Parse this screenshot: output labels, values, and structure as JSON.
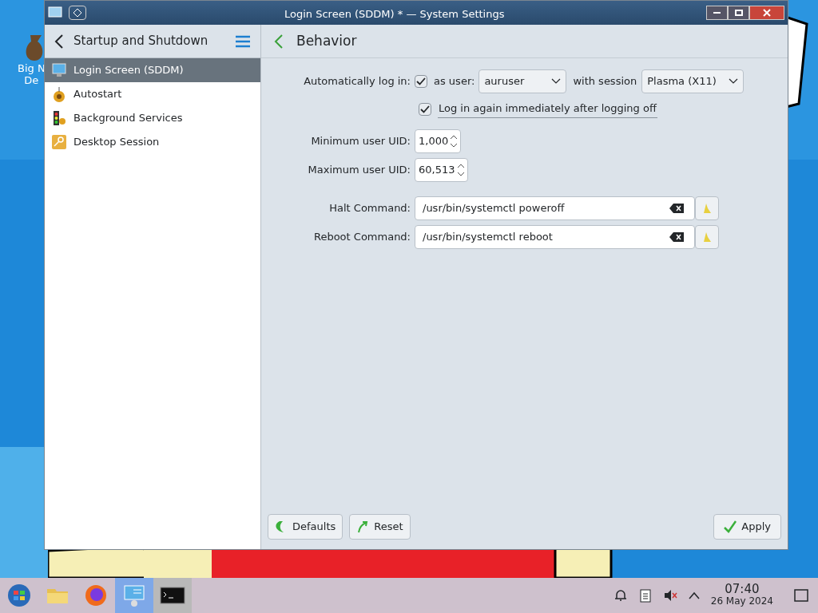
{
  "desktop": {
    "icon_label_lines": [
      "Big N",
      "De"
    ]
  },
  "window": {
    "title": "Login Screen (SDDM) * — System Settings"
  },
  "sidebar": {
    "title": "Startup and Shutdown",
    "items": [
      {
        "label": "Login Screen (SDDM)",
        "kind": "monitor",
        "selected": true
      },
      {
        "label": "Autostart",
        "kind": "gears",
        "selected": false
      },
      {
        "label": "Background Services",
        "kind": "traffic",
        "selected": false
      },
      {
        "label": "Desktop Session",
        "kind": "key",
        "selected": false
      }
    ]
  },
  "page": {
    "title": "Behavior",
    "autologin": {
      "label": "Automatically log in:",
      "checked": true,
      "user_label": "as user:",
      "user": "auruser",
      "session_label": "with session",
      "session": "Plasma (X11)"
    },
    "relogin": {
      "label": "Log in again immediately after logging off",
      "checked": true
    },
    "min_uid": {
      "label": "Minimum user UID:",
      "value": "1,000"
    },
    "max_uid": {
      "label": "Maximum user UID:",
      "value": "60,513"
    },
    "commands": [
      {
        "label": "Halt Command:",
        "value": "/usr/bin/systemctl poweroff"
      },
      {
        "label": "Reboot Command:",
        "value": "/usr/bin/systemctl reboot"
      }
    ]
  },
  "buttons": [
    {
      "label": "Defaults",
      "kind": "defaults"
    },
    {
      "label": "Reset",
      "kind": "reset"
    },
    {
      "label": "Apply",
      "kind": "apply"
    }
  ],
  "taskbar": {
    "time": "07:40",
    "date": "26 May 2024",
    "apps": [
      {
        "kind": "start",
        "selected": false
      },
      {
        "kind": "files",
        "selected": false
      },
      {
        "kind": "browser",
        "selected": false
      },
      {
        "kind": "settings",
        "selected": true
      },
      {
        "kind": "terminal",
        "selected": false
      }
    ]
  }
}
